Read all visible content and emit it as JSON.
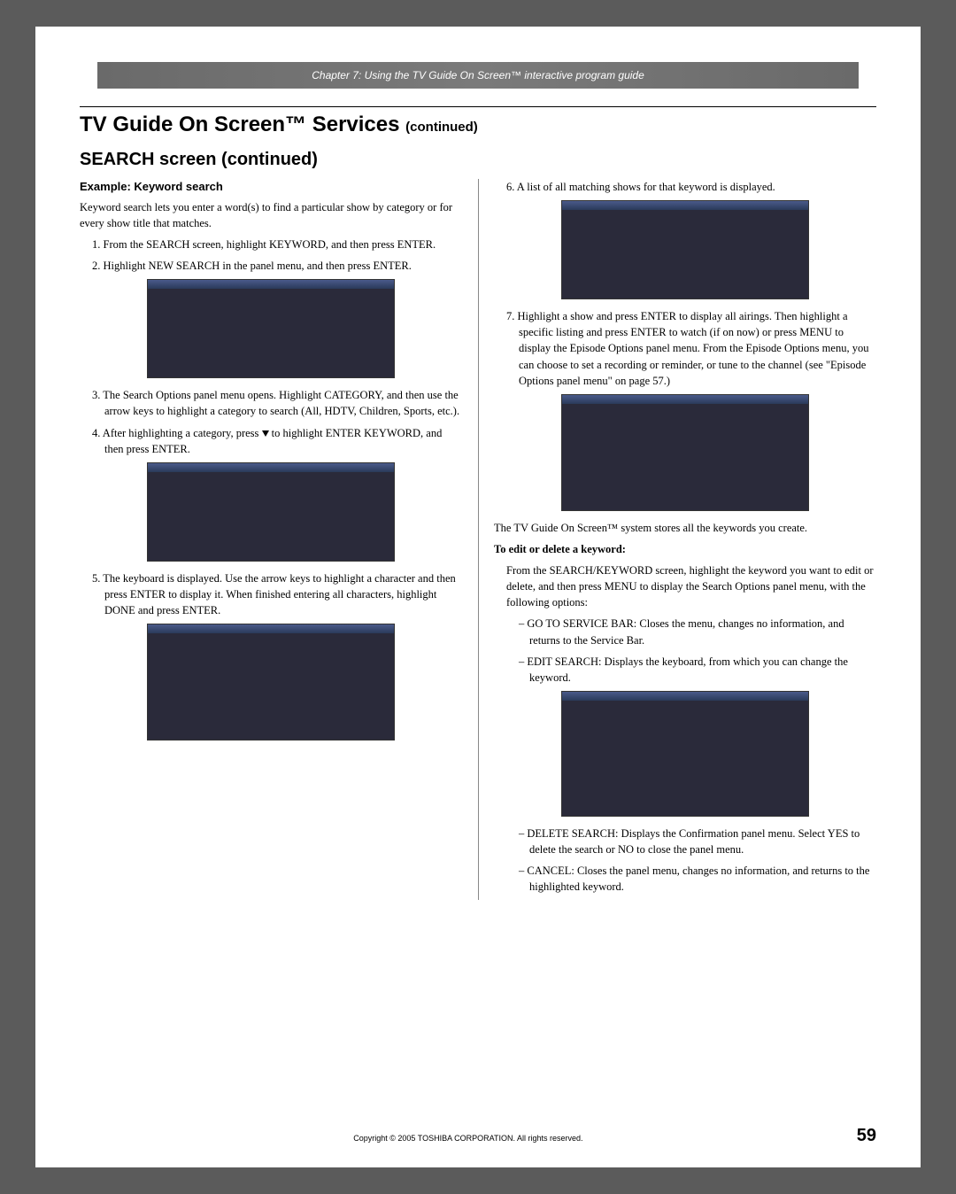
{
  "chapter_banner": "Chapter 7: Using the TV Guide On Screen™ interactive program guide",
  "main_title": "TV Guide On Screen™ Services",
  "main_title_cont": "(continued)",
  "section_title": "SEARCH screen (continued)",
  "example_heading": "Example: Keyword search",
  "intro": "Keyword search lets you enter a word(s) to find a particular show by category or for every show title that matches.",
  "steps_left": {
    "s1": "1. From the SEARCH screen, highlight KEYWORD, and then press ENTER.",
    "s2": "2. Highlight NEW SEARCH in the panel menu, and then press ENTER.",
    "s3": "3. The Search Options panel menu opens. Highlight CATEGORY, and then use the arrow keys to highlight a category to search (All, HDTV, Children, Sports, etc.).",
    "s4_pre": "4. After highlighting a category, press ",
    "s4_post": " to highlight ENTER KEYWORD, and then press ENTER.",
    "s5": "5. The keyboard is displayed. Use the arrow keys to highlight a character and then press ENTER to display it. When finished entering all characters, highlight DONE and press ENTER."
  },
  "steps_right": {
    "s6": "6. A list of all matching shows for that keyword is displayed.",
    "s7": "7. Highlight a show and press ENTER to display all airings. Then highlight a specific listing and press ENTER to watch (if on now) or press MENU to display the Episode Options panel menu. From the Episode Options menu, you can choose to set a recording or reminder, or tune to the channel (see \"Episode Options panel menu\" on page 57.)"
  },
  "stores_text": "The TV Guide On Screen™ system stores all the keywords you create.",
  "to_edit_heading": "To edit or delete a keyword:",
  "to_edit_intro": "From the SEARCH/KEYWORD screen, highlight the keyword you want to edit or delete, and then press MENU to display the Search Options panel menu, with the following options:",
  "options": {
    "o1": "– GO TO SERVICE BAR: Closes the menu, changes no information, and returns to the Service Bar.",
    "o2": "– EDIT SEARCH: Displays the keyboard, from which you can change the keyword.",
    "o3": "– DELETE SEARCH: Displays the Confirmation panel menu. Select YES to delete the search or NO to close the panel menu.",
    "o4": "– CANCEL: Closes the panel menu, changes no information, and returns to the highlighted keyword."
  },
  "copyright": "Copyright © 2005 TOSHIBA CORPORATION. All rights reserved.",
  "page_number": "59"
}
